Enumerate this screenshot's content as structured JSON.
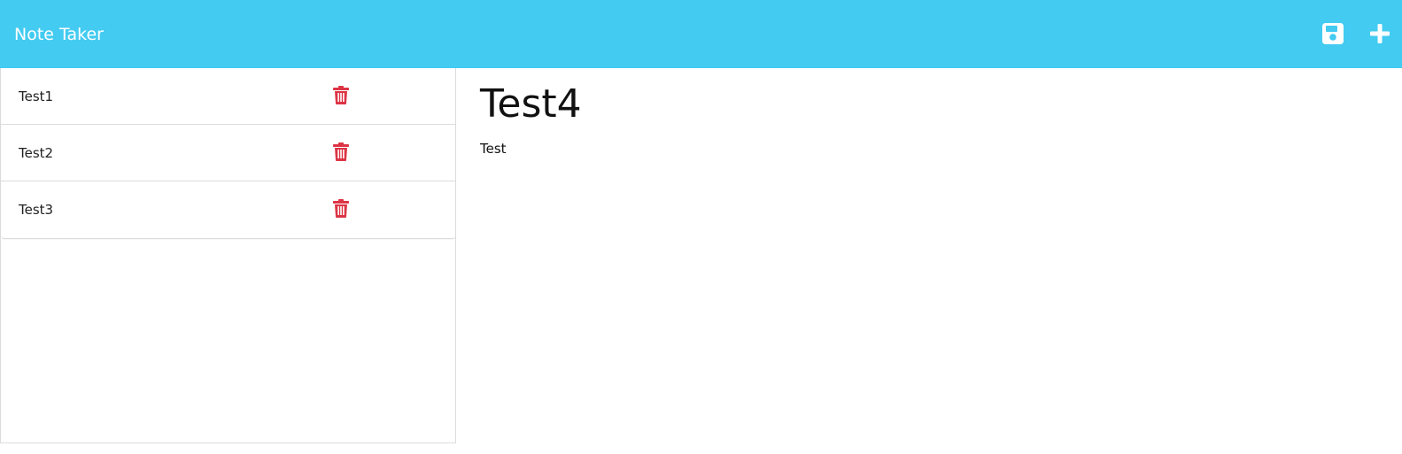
{
  "navbar": {
    "brand": "Note Taker",
    "save_icon": "save-icon",
    "new_icon": "plus-icon",
    "background": "#43cbf1"
  },
  "notes": [
    {
      "title": "Test1",
      "delete_icon": "trash-icon"
    },
    {
      "title": "Test2",
      "delete_icon": "trash-icon"
    },
    {
      "title": "Test3",
      "delete_icon": "trash-icon"
    }
  ],
  "editor": {
    "title": "Test4",
    "body": "Test"
  },
  "colors": {
    "accent": "#43cbf1",
    "delete": "#dc3545"
  }
}
